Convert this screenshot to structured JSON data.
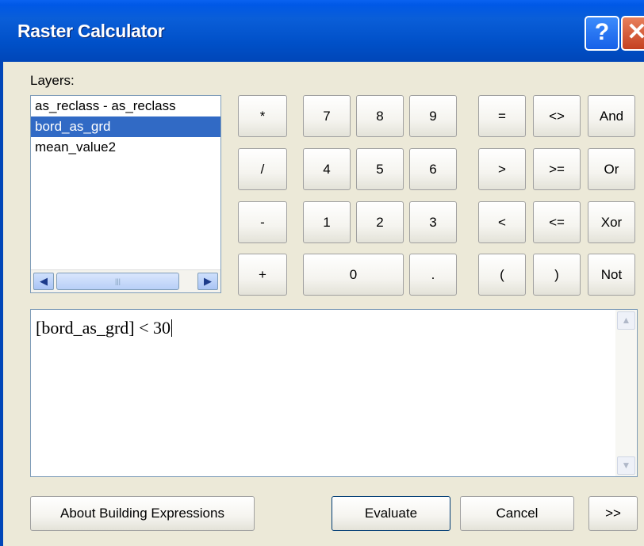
{
  "window": {
    "title": "Raster Calculator",
    "help_glyph": "?",
    "close_glyph": "✕"
  },
  "layers": {
    "label": "Layers:",
    "items": [
      "as_reclass - as_reclass",
      "bord_as_grd",
      "mean_value2"
    ],
    "selected_index": 1,
    "scroll_left": "◀",
    "scroll_right": "▶",
    "thumb_grip": "|||"
  },
  "keypad": {
    "operators": [
      "*",
      "/",
      "-",
      "+"
    ],
    "digits_row1": [
      "7",
      "8",
      "9"
    ],
    "digits_row2": [
      "4",
      "5",
      "6"
    ],
    "digits_row3": [
      "1",
      "2",
      "3"
    ],
    "zero": "0",
    "dot": ".",
    "compare_row1": [
      "=",
      "<>",
      "And"
    ],
    "compare_row2": [
      ">",
      ">=",
      "Or"
    ],
    "compare_row3": [
      "<",
      "<=",
      "Xor"
    ],
    "compare_row4": [
      "(",
      ")",
      "Not"
    ]
  },
  "expression": {
    "value": "[bord_as_grd] < 30",
    "scroll_up": "▲",
    "scroll_down": "▼"
  },
  "buttons": {
    "about": "About Building Expressions",
    "evaluate": "Evaluate",
    "cancel": "Cancel",
    "more": ">>"
  }
}
